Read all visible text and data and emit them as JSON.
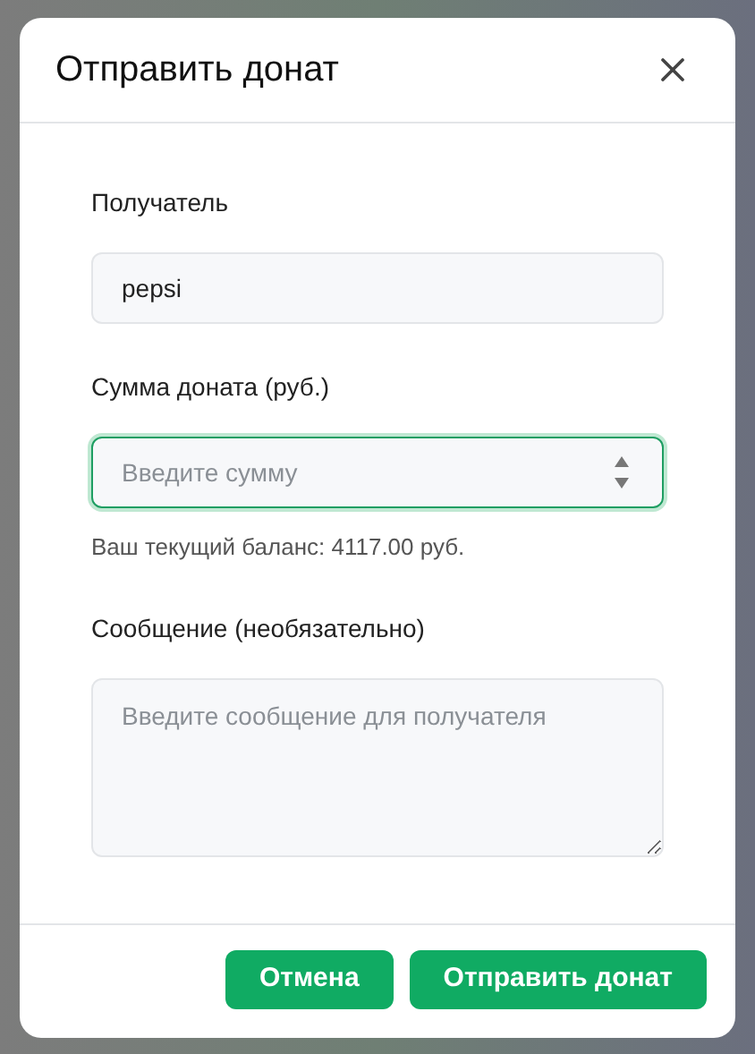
{
  "dialog": {
    "title": "Отправить донат"
  },
  "fields": [
    {
      "kind": "text",
      "label": "Получатель",
      "value": "pepsi",
      "focused": false
    },
    {
      "kind": "number",
      "label": "Сумма доната (руб.)",
      "placeholder": "Введите сумму",
      "focused": true,
      "hint": "Ваш текущий баланс: 4117.00 руб."
    },
    {
      "kind": "textarea",
      "label": "Сообщение (необязательно)",
      "placeholder": "Введите сообщение для получателя",
      "focused": false
    }
  ],
  "buttons": [
    "Отмена",
    "Отправить донат"
  ]
}
